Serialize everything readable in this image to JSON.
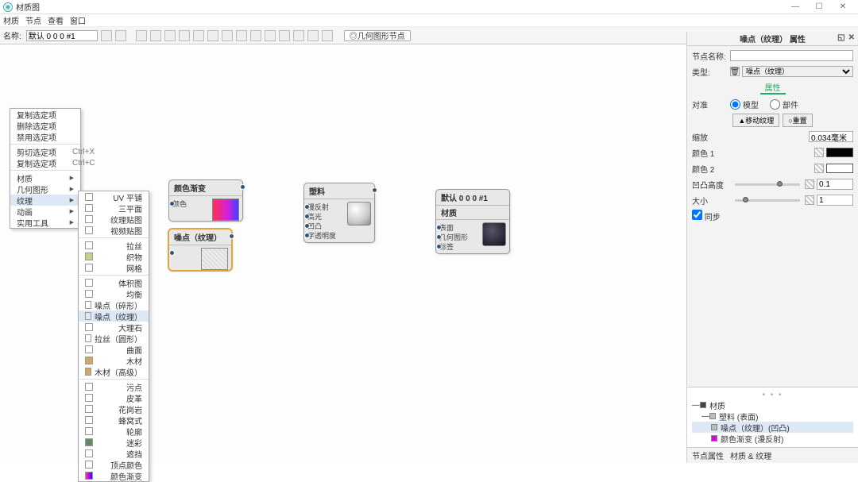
{
  "titlebar": {
    "title": "材质图"
  },
  "menubar": {
    "items": [
      "材质",
      "节点",
      "查看",
      "窗口"
    ]
  },
  "toolbar": {
    "name_label": "名称:",
    "name_value": "默认 0 0 0 #1",
    "breadcrumb": "◎几何图形节点"
  },
  "ctx1": {
    "items": [
      {
        "label": "复制选定项"
      },
      {
        "label": "删除选定项"
      },
      {
        "label": "禁用选定项"
      }
    ],
    "items2": [
      {
        "label": "剪切选定项",
        "shortcut": "Ctrl+X"
      },
      {
        "label": "复制选定项",
        "shortcut": "Ctrl+C"
      }
    ],
    "items3": [
      {
        "label": "材质",
        "arrow": true
      },
      {
        "label": "几何图形",
        "arrow": true
      },
      {
        "label": "纹理",
        "arrow": true,
        "hover": true
      },
      {
        "label": "动画",
        "arrow": true
      },
      {
        "label": "实用工具",
        "arrow": true
      }
    ]
  },
  "ctx2": {
    "groups": [
      [
        "UV 平铺",
        "三平面",
        "纹理贴图",
        "视频贴图"
      ],
      [
        "拉丝",
        "织物",
        "网格"
      ],
      [
        "体积图",
        "均衡",
        "噪点（碎形）",
        "噪点（纹理）",
        "大理石",
        "拉丝（圆形）",
        "曲面",
        "木材",
        "木材（高级）"
      ],
      [
        "污点",
        "皮革",
        "花岗岩",
        "蜂窝式",
        "轮廓",
        "迷彩",
        "遮挡",
        "顶点颜色",
        "颜色渐变"
      ]
    ],
    "highlight": "噪点（纹理）"
  },
  "nodes": {
    "n1": {
      "title": "颜色渐变",
      "rows": [
        "颜色"
      ]
    },
    "n2": {
      "title": "噪点（纹理）"
    },
    "n3": {
      "title": "塑料",
      "rows": [
        "漫反射",
        "高光",
        "凹凸",
        "字透明度"
      ]
    },
    "n4": {
      "title": "默认 0 0 0 #1",
      "rows": [
        "表面",
        "几何图形",
        "标签"
      ]
    },
    "n4_header_prefix": "材质"
  },
  "rightpanel": {
    "header": "噪点（纹理） 属性",
    "node_name_label": "节点名称:",
    "node_name_value": "",
    "type_label": "类型:",
    "type_value": "噪点（纹理）",
    "tab": "属性",
    "target_label": "对准",
    "radio_model": "模型",
    "radio_part": "部件",
    "btn_move": "▲移动纹理",
    "btn_reset": "○重置",
    "scale_label": "缩放",
    "scale_value": "0.034毫米",
    "color1_label": "颜色 1",
    "color2_label": "颜色 2",
    "bump_label": "凹凸高度",
    "bump_value": "0.1",
    "size_label": "大小",
    "size_value": "1",
    "sync_label": "同步"
  },
  "tree": {
    "root": "材质",
    "items": [
      {
        "label": "塑料 (表面)"
      },
      {
        "label": "噪点（纹理）(凹凸)"
      },
      {
        "label": "颜色渐变 (漫反射)"
      }
    ]
  },
  "footer": {
    "tab1": "节点属性",
    "tab2": "材质 & 纹理"
  }
}
